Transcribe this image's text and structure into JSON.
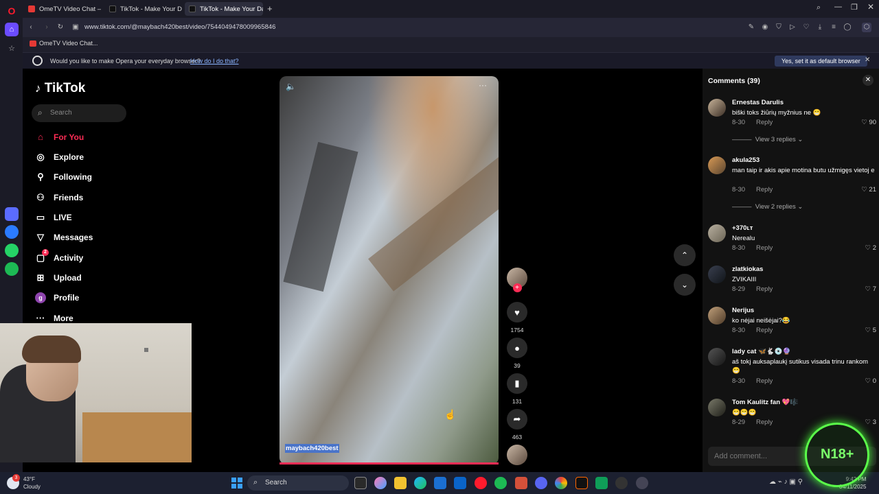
{
  "browser": {
    "tabs": [
      {
        "label": "OmeTV Video Chat — On"
      },
      {
        "label": "TikTok - Make Your Day"
      },
      {
        "label": "TikTok - Make Your Day"
      }
    ],
    "url": "www.tiktok.com/@maybach420best/video/7544049478009965846",
    "bookmark": "OmeTV Video Chat...",
    "notification": {
      "text": "Would you like to make Opera your everyday browser?",
      "link": "How do I do that?",
      "button": "Yes, set it as default browser"
    }
  },
  "tiktok": {
    "logo": "TikTok",
    "search_placeholder": "Search",
    "nav": [
      {
        "label": "For You",
        "icon": "home-icon"
      },
      {
        "label": "Explore",
        "icon": "compass-icon"
      },
      {
        "label": "Following",
        "icon": "following-icon"
      },
      {
        "label": "Friends",
        "icon": "friends-icon"
      },
      {
        "label": "LIVE",
        "icon": "live-icon"
      },
      {
        "label": "Messages",
        "icon": "messages-icon"
      },
      {
        "label": "Activity",
        "icon": "activity-icon",
        "badge": "2"
      },
      {
        "label": "Upload",
        "icon": "upload-icon"
      },
      {
        "label": "Profile",
        "icon": "profile-icon",
        "avatar_letter": "g"
      },
      {
        "label": "More",
        "icon": "more-icon"
      }
    ],
    "video": {
      "author": "maybach420best",
      "likes": "1754",
      "comments": "39",
      "saves": "131",
      "shares": "463"
    },
    "comments_panel": {
      "title": "Comments (39)",
      "add_placeholder": "Add comment...",
      "items": [
        {
          "user": "Ernestas Darulis",
          "text": "biški toks žiūrių myžnius ne 😁",
          "date": "8-30",
          "reply": "Reply",
          "likes": "90",
          "views": "View 3 replies"
        },
        {
          "user": "akula253",
          "text": "man taip ir akis apie motina butu užmigęs vietoj e",
          "date": "8-30",
          "reply": "Reply",
          "likes": "21",
          "views": "View 2 replies"
        },
        {
          "user": "+370ʟᴛ",
          "text": "Nerealu",
          "date": "8-30",
          "reply": "Reply",
          "likes": "2"
        },
        {
          "user": "zlatkiokas",
          "text": "ZVIKAIII",
          "date": "8-29",
          "reply": "Reply",
          "likes": "7"
        },
        {
          "user": "Nerijus",
          "text": "ko nėjai neišėjai?😂",
          "date": "8-30",
          "reply": "Reply",
          "likes": "5"
        },
        {
          "user": "lady cat 🦋🐇💿🔮",
          "text": "aš tokj auksaplaukį sutikus visada trinu rankom 😁",
          "date": "8-30",
          "reply": "Reply",
          "likes": "0"
        },
        {
          "user": "Tom Kaulitz fan 💖🎼",
          "text": "😁😁😁",
          "date": "8-29",
          "reply": "Reply",
          "likes": "3"
        }
      ]
    }
  },
  "overlay": {
    "badge": "N18+"
  },
  "taskbar": {
    "weather_temp": "43°F",
    "weather_desc": "Cloudy",
    "weather_badge": "3",
    "search": "Search",
    "time": "9:42 PM",
    "date": "04/11/2025"
  }
}
